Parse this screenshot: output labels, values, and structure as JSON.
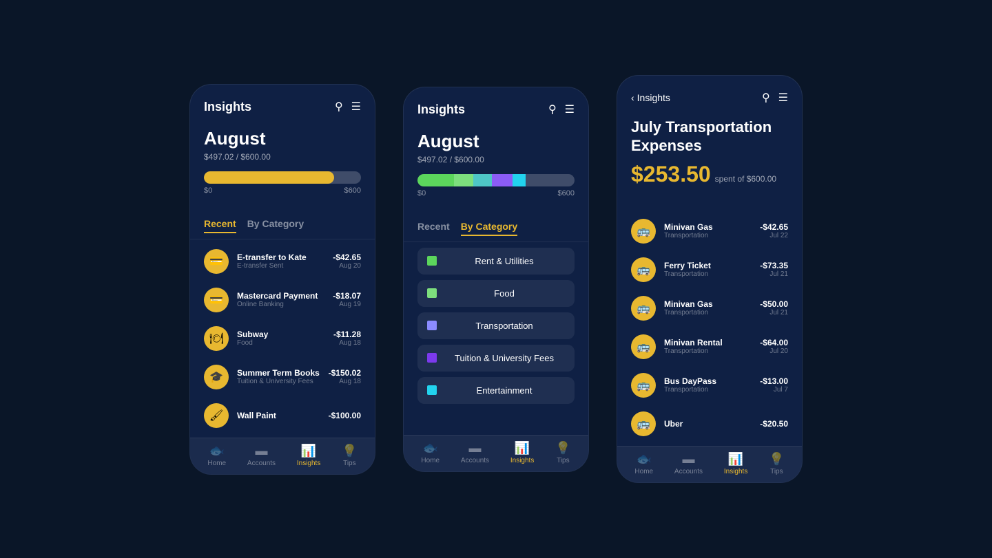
{
  "screen1": {
    "title": "Insights",
    "month": "August",
    "budget_used": "$497.02 / $600.00",
    "progress_min": "$0",
    "progress_max": "$600",
    "tab_recent": "Recent",
    "tab_category": "By Category",
    "active_tab": "recent",
    "transactions": [
      {
        "name": "E-transfer to Kate",
        "sub": "E-transfer Sent",
        "amount": "-$42.65",
        "date": "Aug 20",
        "icon": "💳"
      },
      {
        "name": "Mastercard Payment",
        "sub": "Online Banking",
        "amount": "-$18.07",
        "date": "Aug 19",
        "icon": "💳"
      },
      {
        "name": "Subway",
        "sub": "Food",
        "amount": "-$11.28",
        "date": "Aug 18",
        "icon": "🍽"
      },
      {
        "name": "Summer Term Books",
        "sub": "Tuition & University Fees",
        "amount": "-$150.02",
        "date": "Aug 18",
        "icon": "🎓"
      },
      {
        "name": "Wall Paint",
        "sub": "",
        "amount": "-$100.00",
        "date": "",
        "icon": "🖌"
      }
    ],
    "nav": {
      "home": "Home",
      "accounts": "Accounts",
      "insights": "Insights",
      "tips": "Tips"
    }
  },
  "screen2": {
    "title": "Insights",
    "month": "August",
    "budget_used": "$497.02 / $600.00",
    "progress_min": "$0",
    "progress_max": "$600",
    "tab_recent": "Recent",
    "tab_category": "By Category",
    "active_tab": "category",
    "categories": [
      {
        "name": "Rent & Utilities",
        "color": "#5cd65c"
      },
      {
        "name": "Food",
        "color": "#7ddf7d"
      },
      {
        "name": "Transportation",
        "color": "#8b8bff"
      },
      {
        "name": "Tuition & University Fees",
        "color": "#7c3aed"
      },
      {
        "name": "Entertainment",
        "color": "#22d3ee"
      }
    ],
    "nav": {
      "home": "Home",
      "accounts": "Accounts",
      "insights": "Insights",
      "tips": "Tips"
    }
  },
  "screen3": {
    "back_label": "Insights",
    "title": "July Transportation Expenses",
    "amount": "$253.50",
    "spent_label": "spent of $600.00",
    "transactions": [
      {
        "name": "Minivan Gas",
        "sub": "Transportation",
        "amount": "-$42.65",
        "date": "Jul 22"
      },
      {
        "name": "Ferry Ticket",
        "sub": "Transportation",
        "amount": "-$73.35",
        "date": "Jul 21"
      },
      {
        "name": "Minivan Gas",
        "sub": "Transportation",
        "amount": "-$50.00",
        "date": "Jul 21"
      },
      {
        "name": "Minivan Rental",
        "sub": "Transportation",
        "amount": "-$64.00",
        "date": "Jul 20"
      },
      {
        "name": "Bus DayPass",
        "sub": "Transportation",
        "amount": "-$13.00",
        "date": "Jul 7"
      },
      {
        "name": "Uber",
        "sub": "",
        "amount": "-$20.50",
        "date": ""
      }
    ],
    "nav": {
      "home": "Home",
      "accounts": "Accounts",
      "insights": "Insights",
      "tips": "Tips"
    }
  }
}
